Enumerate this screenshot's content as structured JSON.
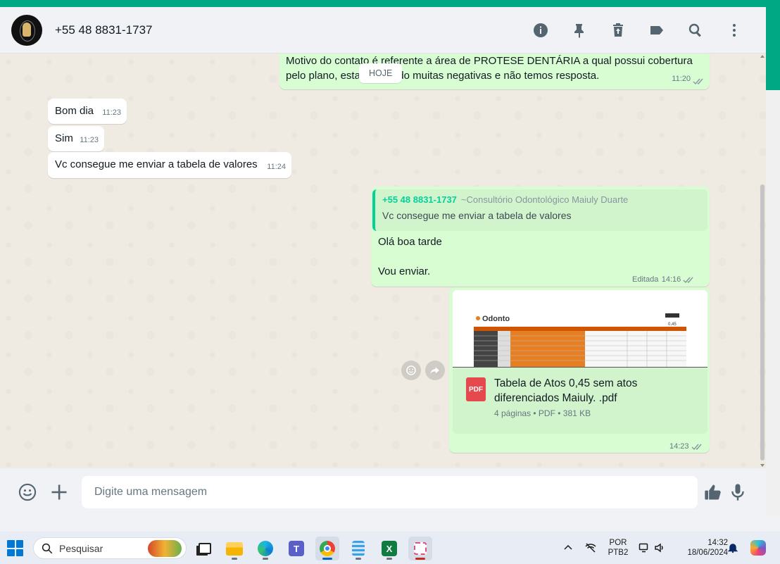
{
  "header": {
    "contact_name": "+55 48 8831-1737"
  },
  "chat": {
    "date_chip": "HOJE",
    "messages": [
      {
        "dir": "out",
        "line1": "Motivo do contato é referente a área de PROTESE DENTÁRIA a qual possui cobertura",
        "line2": "pelo plano, estamos tendo muitas negativas e não temos resposta.",
        "time": "11:20"
      },
      {
        "dir": "in",
        "text": "Bom dia",
        "time": "11:23"
      },
      {
        "dir": "in",
        "text": "Sim",
        "time": "11:23"
      },
      {
        "dir": "in",
        "text": "Vc consegue me enviar a tabela de valores",
        "time": "11:24"
      },
      {
        "dir": "out",
        "quote_author": "+55 48 8831-1737",
        "quote_pushname": "~Consultório Odontológico Maiuly Duarte",
        "quote_text": "Vc consegue me enviar a tabela de valores",
        "line1": "Olá boa tarde",
        "line2": "Vou enviar.",
        "edited": "Editada",
        "time": "14:16"
      },
      {
        "dir": "out",
        "doc_badge": "PDF",
        "doc_name": "Tabela de Atos 0,45 sem atos diferenciados Maiuly. .pdf",
        "doc_meta": "4 páginas • PDF • 381 KB",
        "thumb_logo": "Odonto",
        "thumb_value": "0,45",
        "time": "14:23"
      }
    ]
  },
  "composer": {
    "placeholder": "Digite uma mensagem"
  },
  "taskbar": {
    "search_label": "Pesquisar",
    "lang_top": "POR",
    "lang_bottom": "PTB2",
    "clock_time": "14:32",
    "clock_date": "18/06/2024"
  },
  "colors": {
    "accent": "#00a884",
    "out_bubble": "#d9fdd3",
    "in_bubble": "#ffffff",
    "chat_bg": "#efeae2"
  }
}
